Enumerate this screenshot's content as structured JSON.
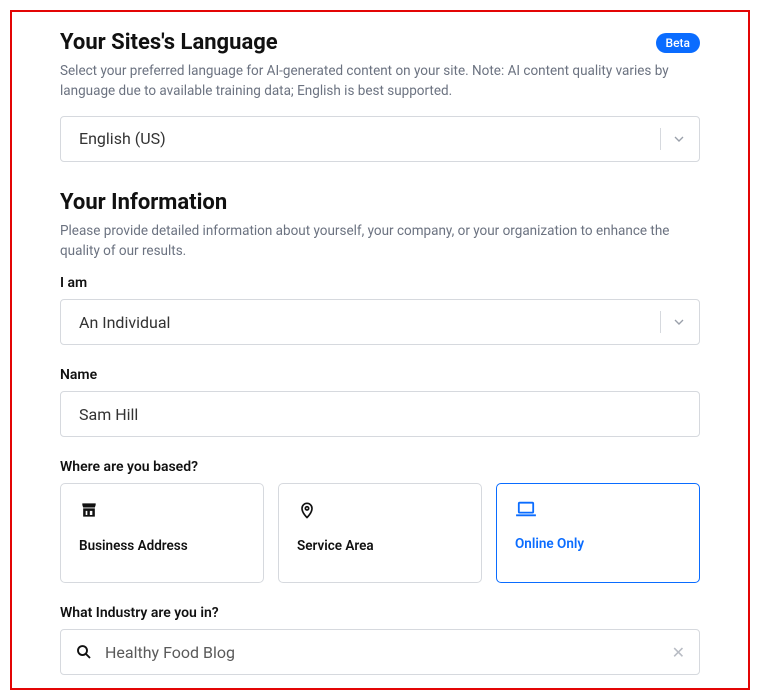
{
  "language_section": {
    "title": "Your Sites's Language",
    "badge": "Beta",
    "description": "Select your preferred language for AI-generated content on your site. Note: AI content quality varies by language due to available training data; English is best supported.",
    "selected": "English (US)"
  },
  "info_section": {
    "title": "Your Information",
    "description": "Please provide detailed information about yourself, your company, or your organization to enhance the quality of our results.",
    "iam_label": "I am",
    "iam_value": "An Individual",
    "name_label": "Name",
    "name_value": "Sam Hill",
    "based_label": "Where are you based?",
    "options": {
      "business": "Business Address",
      "service": "Service Area",
      "online": "Online Only"
    },
    "industry_label": "What Industry are you in?",
    "industry_value": "Healthy Food Blog"
  }
}
